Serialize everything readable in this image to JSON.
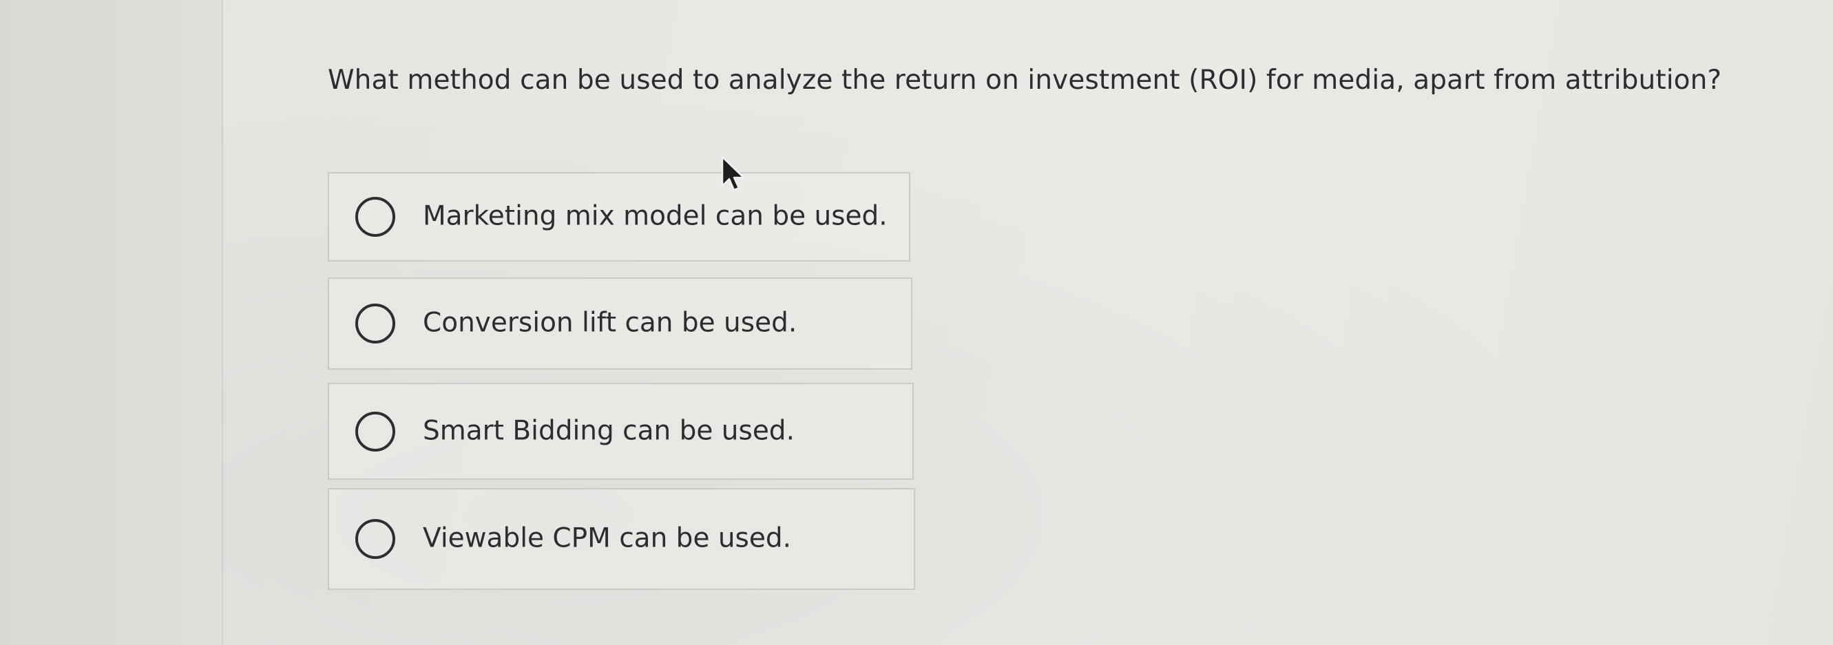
{
  "question": {
    "text": "What method can be used to analyze the return on investment (ROI) for media, apart from attribution?"
  },
  "options": [
    {
      "label": "Marketing mix model can be used.",
      "selected": false
    },
    {
      "label": "Conversion lift can be used.",
      "selected": false
    },
    {
      "label": "Smart Bidding can be used.",
      "selected": false
    },
    {
      "label": "Viewable CPM can be used.",
      "selected": false
    }
  ],
  "icons": {
    "radio": "radio-unselected-icon",
    "cursor": "mouse-pointer-icon"
  }
}
